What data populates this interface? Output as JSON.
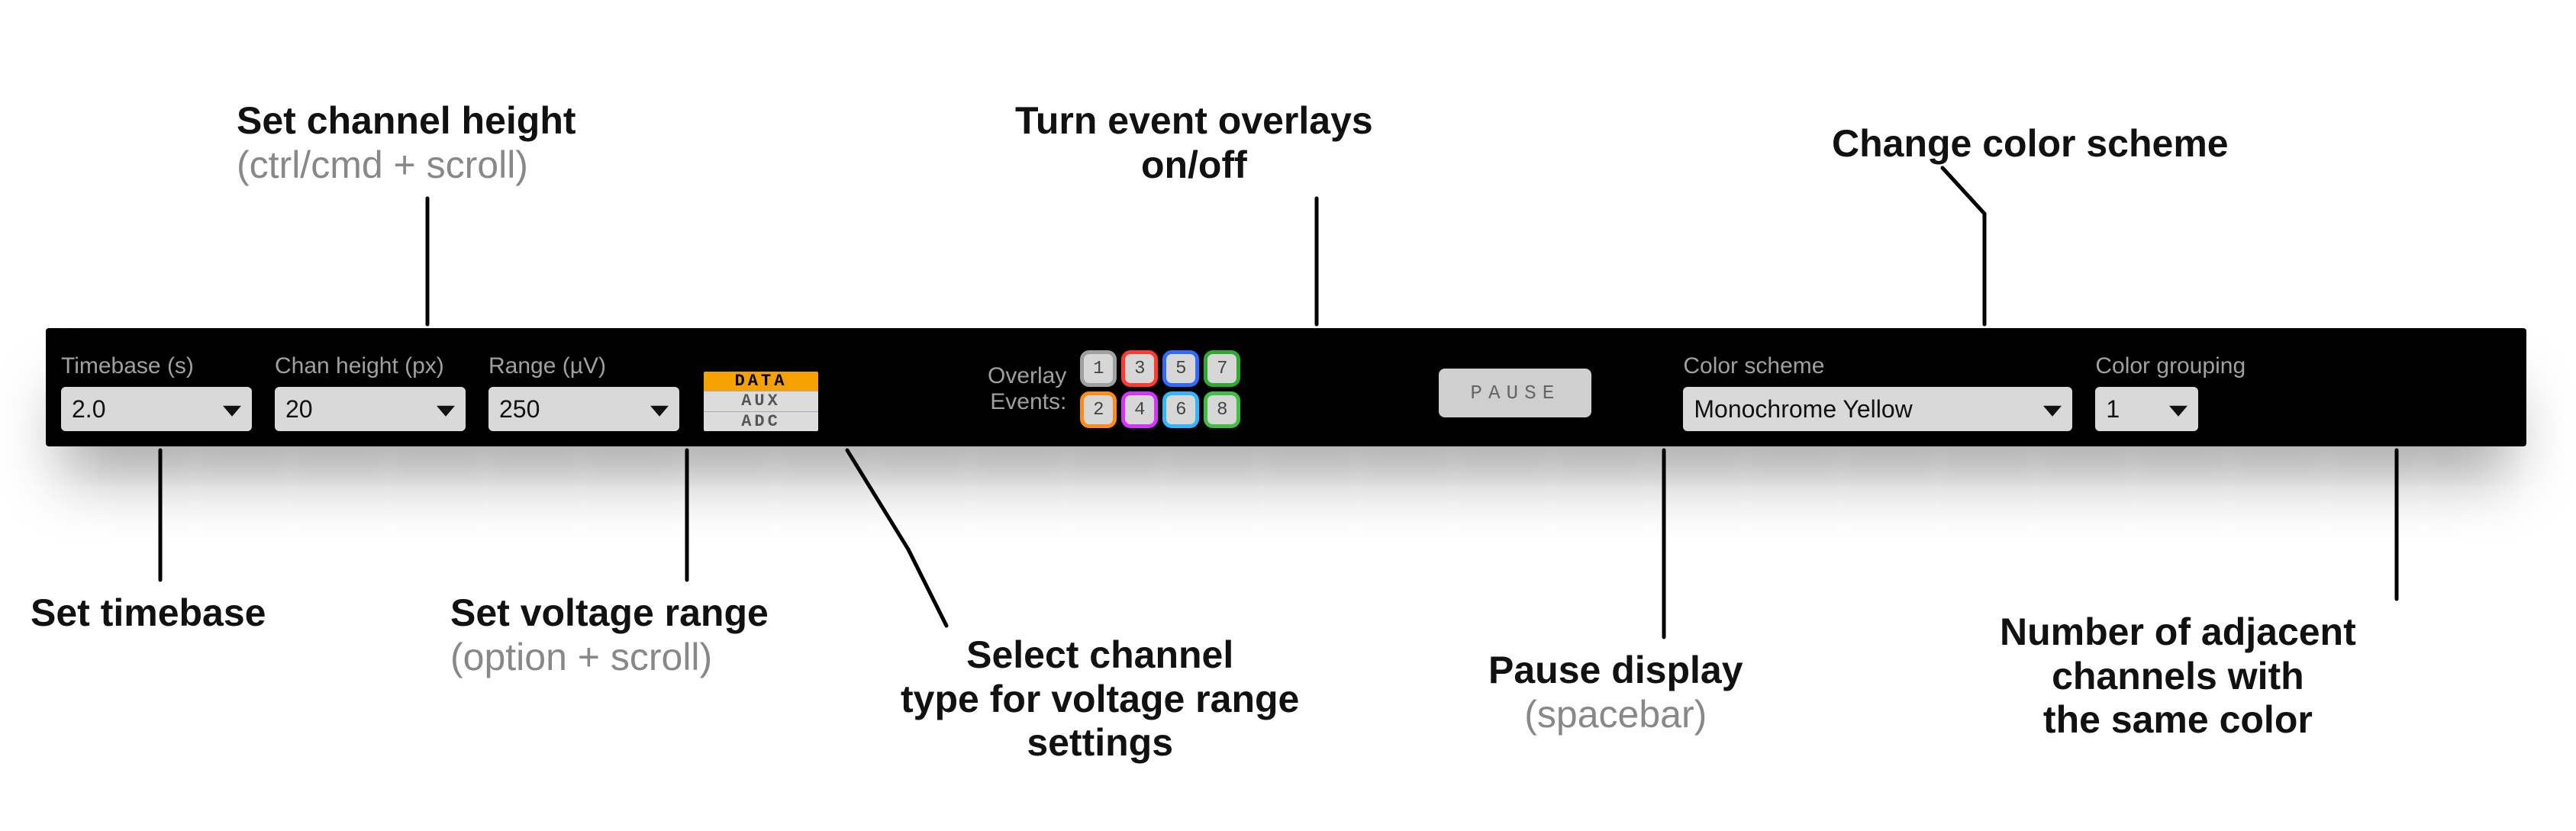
{
  "toolbar": {
    "timebase": {
      "label": "Timebase (s)",
      "value": "2.0"
    },
    "chanheight": {
      "label": "Chan height (px)",
      "value": "20"
    },
    "range": {
      "label": "Range (µV)",
      "value": "250"
    },
    "chan_type": {
      "data": "DATA",
      "aux": "AUX",
      "adc": "ADC"
    },
    "overlay": {
      "label1": "Overlay",
      "label2": "Events:",
      "buttons": [
        "1",
        "3",
        "5",
        "7",
        "2",
        "4",
        "6",
        "8"
      ],
      "colors": [
        "#a0a0a0",
        "#ff3b30",
        "#2f6bff",
        "#2faa2f",
        "#ff8c1a",
        "#d633ff",
        "#30b5ff",
        "#3fc13f"
      ]
    },
    "pause": {
      "label": "PAUSE"
    },
    "scheme": {
      "label": "Color scheme",
      "value": "Monochrome Yellow"
    },
    "grouping": {
      "label": "Color grouping",
      "value": "1"
    }
  },
  "callouts": {
    "chan_height": {
      "title": "Set channel height",
      "sub": "(ctrl/cmd + scroll)"
    },
    "overlays": {
      "title_l1": "Turn event overlays",
      "title_l2": "on/off"
    },
    "scheme": {
      "title": "Change color scheme"
    },
    "timebase": {
      "title": "Set timebase"
    },
    "voltage": {
      "title": "Set voltage range",
      "sub": "(option + scroll)"
    },
    "chan_type": {
      "title_l1": "Select channel",
      "title_l2": "type for voltage range",
      "title_l3": "settings"
    },
    "pause": {
      "title": "Pause display",
      "sub": "(spacebar)"
    },
    "grouping": {
      "title_l1": "Number of adjacent",
      "title_l2": "channels with",
      "title_l3": "the same color"
    }
  }
}
